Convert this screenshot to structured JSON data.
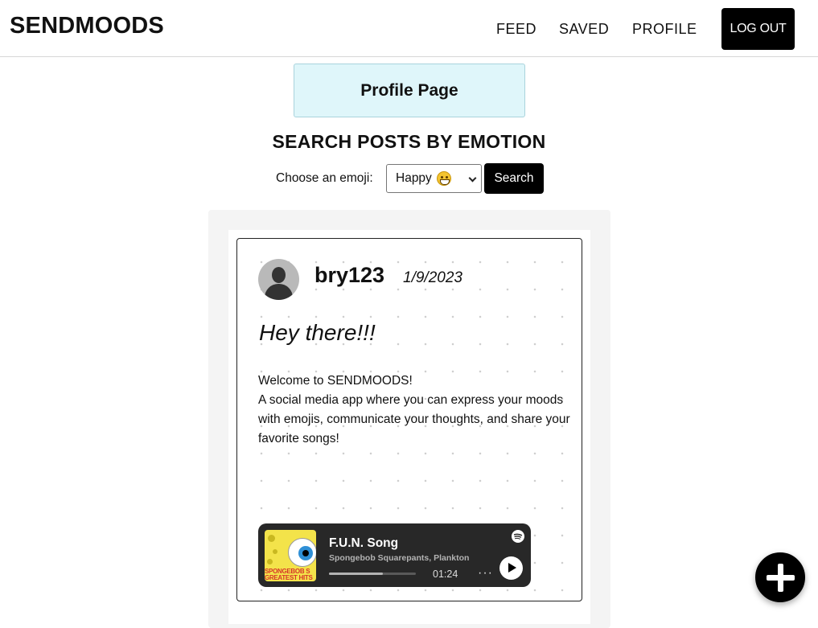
{
  "header": {
    "brand": "SENDMOODS",
    "nav": {
      "feed": "FEED",
      "saved": "SAVED",
      "profile": "PROFILE"
    },
    "logout_label": "LOG OUT"
  },
  "profile_box": {
    "label": "Profile Page"
  },
  "search": {
    "title": "SEARCH POSTS BY EMOTION",
    "label": "Choose an emoji:",
    "selected_emotion": "Happy",
    "selected_emoji_icon": "grinning-face-icon",
    "button_label": "Search"
  },
  "post": {
    "username": "bry123",
    "date": "1/9/2023",
    "title": "Hey there!!!",
    "body_lines": [
      "Welcome to SENDMOODS!",
      "A social media app where you can express your moods with emojis, communicate your thoughts, and share your favorite songs!"
    ],
    "song": {
      "name": "F.U.N. Song",
      "artist": "Spongebob Squarepants, Plankton",
      "time": "01:24",
      "progress": 0.62,
      "cover_text_1": "SPONGEBOB S",
      "cover_text_2": "GREATEST HITS",
      "more_label": "···"
    }
  },
  "colors": {
    "brand_text": "#111111",
    "button_bg": "#000000",
    "profile_box_bg": "#dff6fa",
    "player_bg": "#282828"
  }
}
